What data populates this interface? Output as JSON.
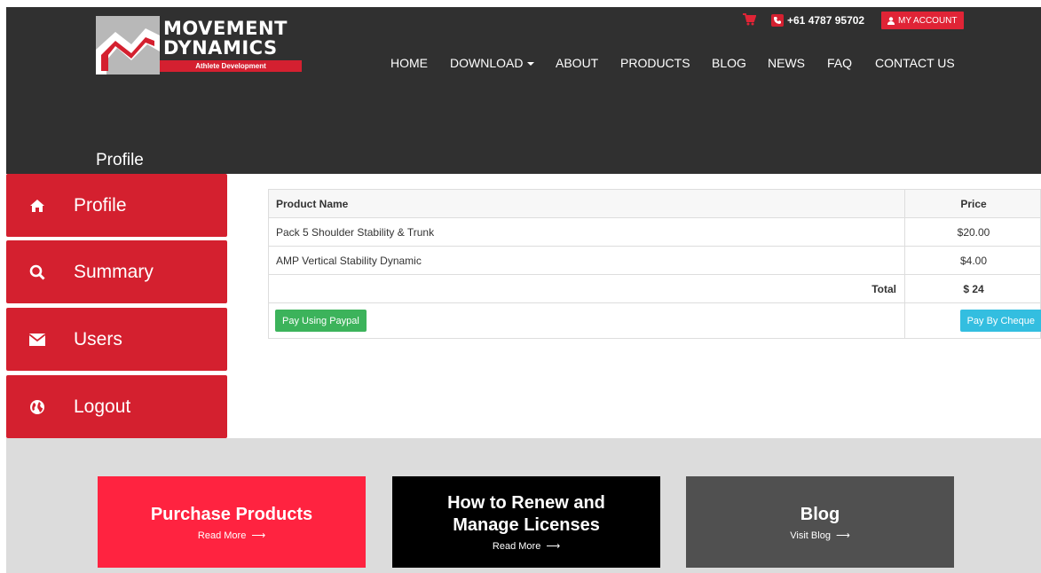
{
  "brand": {
    "line1": "MOVEMENT",
    "line2": "DYNAMICS",
    "tagline": "Athlete Development",
    "colors": {
      "red": "#d4202f",
      "dark": "#303030"
    }
  },
  "topbar": {
    "cart_icon": "shopping-cart-icon",
    "phone": "+61 4787 95702",
    "account_label": "MY ACCOUNT"
  },
  "nav": {
    "home": "HOME",
    "download": "DOWNLOAD",
    "about": "ABOUT",
    "products": "PRODUCTS",
    "blog": "BLOG",
    "news": "NEWS",
    "faq": "FAQ",
    "contact": "CONTACT US"
  },
  "page_title": "Profile",
  "sidebar": {
    "items": [
      {
        "label": "Profile",
        "icon": "home-icon"
      },
      {
        "label": "Summary",
        "icon": "search-icon"
      },
      {
        "label": "Users",
        "icon": "envelope-icon"
      },
      {
        "label": "Logout",
        "icon": "globe-icon"
      }
    ]
  },
  "cart": {
    "headers": {
      "name": "Product Name",
      "price": "Price"
    },
    "rows": [
      {
        "name": "Pack 5 Shoulder Stability & Trunk",
        "price": "$20.00"
      },
      {
        "name": "AMP Vertical Stability Dynamic",
        "price": "$4.00"
      }
    ],
    "total_label": "Total",
    "total_value": "$ 24",
    "paypal_label": "Pay Using Paypal",
    "cheque_label": "Pay By Cheque"
  },
  "cards": [
    {
      "title": "Purchase Products",
      "link": "Read More",
      "color": "#ff2340"
    },
    {
      "title": "How to Renew and Manage Licenses",
      "link": "Read More",
      "color": "#000000"
    },
    {
      "title": "Blog",
      "link": "Visit Blog",
      "color": "#505050"
    }
  ]
}
